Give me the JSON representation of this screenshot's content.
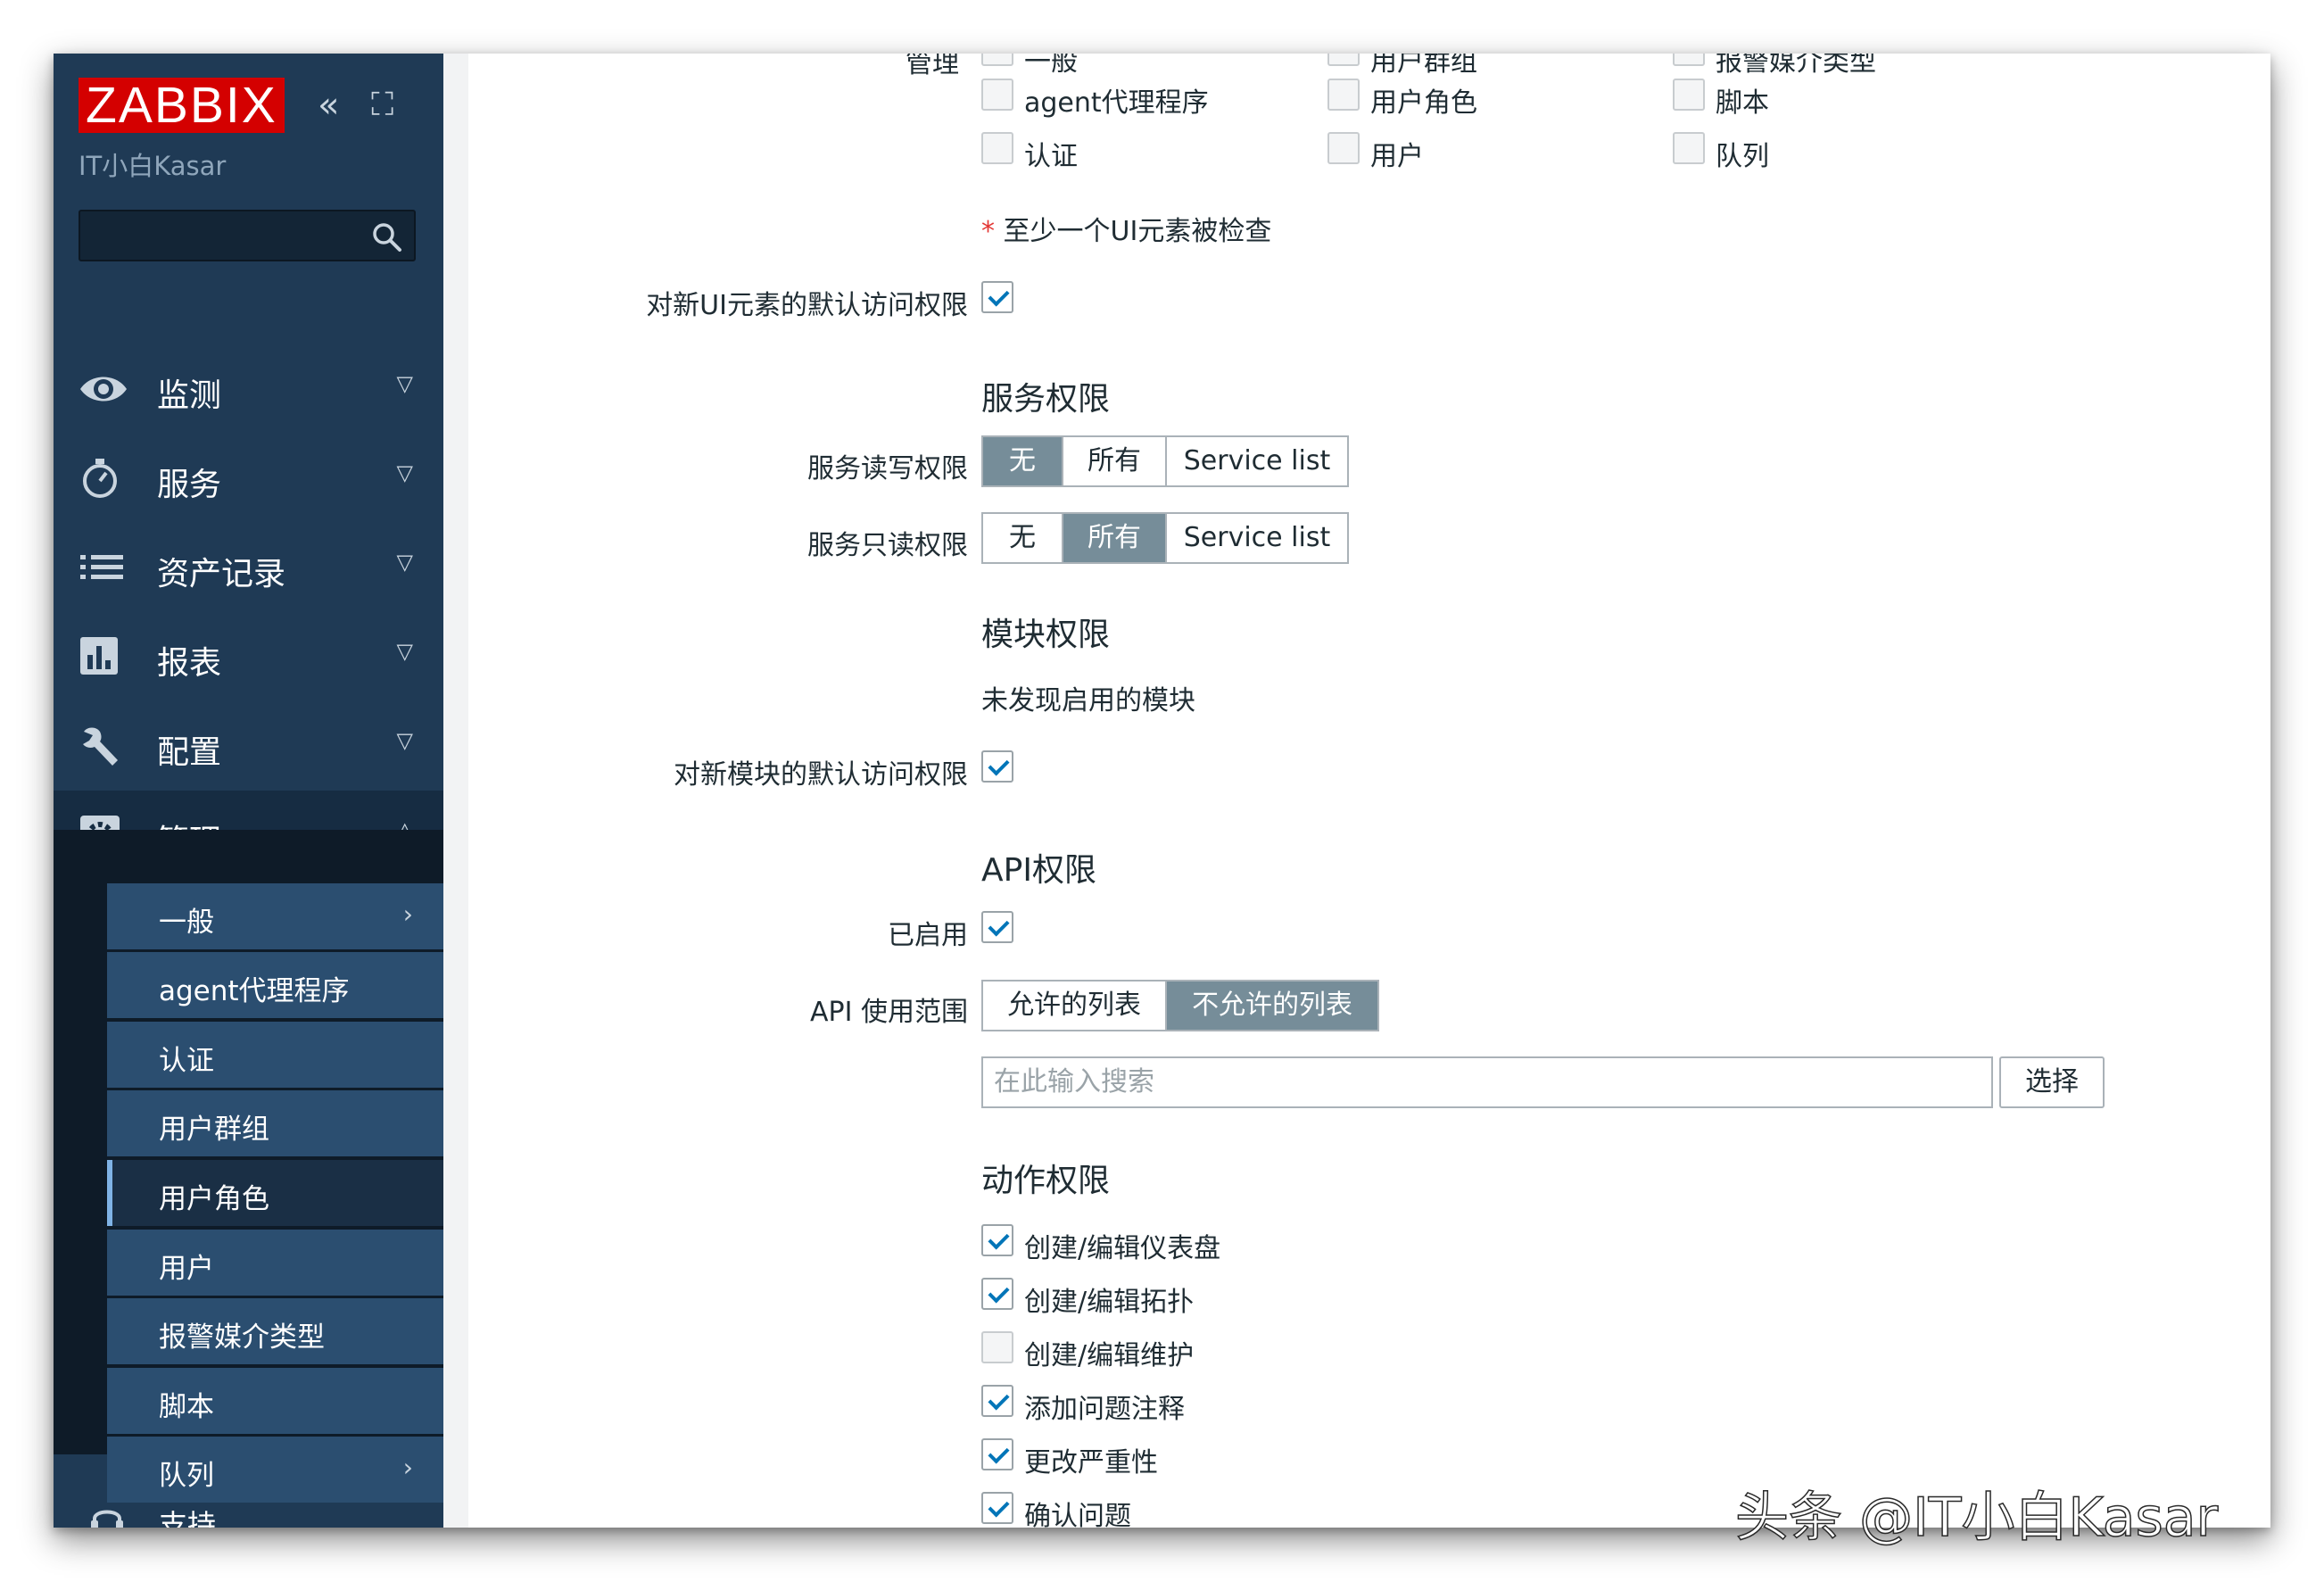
{
  "sidebar": {
    "logo": "ZABBIX",
    "collapse_icon": "«",
    "kiosk_icon": "⛶",
    "instance_name": "IT小白Kasar",
    "search_placeholder": "",
    "menu": [
      {
        "label": "监测",
        "icon": "eye-icon"
      },
      {
        "label": "服务",
        "icon": "stopwatch-icon"
      },
      {
        "label": "资产记录",
        "icon": "list-icon"
      },
      {
        "label": "报表",
        "icon": "bar-chart-icon"
      },
      {
        "label": "配置",
        "icon": "wrench-icon"
      },
      {
        "label": "管理",
        "icon": "gear-icon"
      }
    ],
    "submenu": [
      "一般",
      "agent代理程序",
      "认证",
      "用户群组",
      "用户角色",
      "用户",
      "报警媒介类型",
      "脚本",
      "队列"
    ],
    "support": "支持"
  },
  "ui_elements": {
    "top_cutoff": [
      "管理",
      "一般",
      "用户群组",
      "报警媒介类型"
    ],
    "row1": [
      "agent代理程序",
      "用户角色",
      "脚本"
    ],
    "row2": [
      "认证",
      "用户",
      "队列"
    ],
    "required_note": "至少一个UI元素被检查",
    "default_access_label": "对新UI元素的默认访问权限"
  },
  "service_permissions": {
    "heading": "服务权限",
    "read_write_label": "服务读写权限",
    "read_only_label": "服务只读权限",
    "options": [
      "无",
      "所有",
      "Service list"
    ],
    "read_write_selected": "无",
    "read_only_selected": "所有"
  },
  "module_permissions": {
    "heading": "模块权限",
    "empty_text": "未发现启用的模块",
    "default_access_label": "对新模块的默认访问权限"
  },
  "api_permissions": {
    "heading": "API权限",
    "enabled_label": "已启用",
    "scope_label": "API 使用范围",
    "scope_options": [
      "允许的列表",
      "不允许的列表"
    ],
    "scope_selected": "不允许的列表",
    "search_placeholder": "在此输入搜索",
    "select_button": "选择"
  },
  "action_permissions": {
    "heading": "动作权限",
    "items": [
      {
        "label": "创建/编辑仪表盘",
        "checked": true
      },
      {
        "label": "创建/编辑拓扑",
        "checked": true
      },
      {
        "label": "创建/编辑维护",
        "checked": false
      },
      {
        "label": "添加问题注释",
        "checked": true
      },
      {
        "label": "更改严重性",
        "checked": true
      },
      {
        "label": "确认问题",
        "checked": true
      }
    ]
  },
  "watermark": "头条 @IT小白Kasar"
}
